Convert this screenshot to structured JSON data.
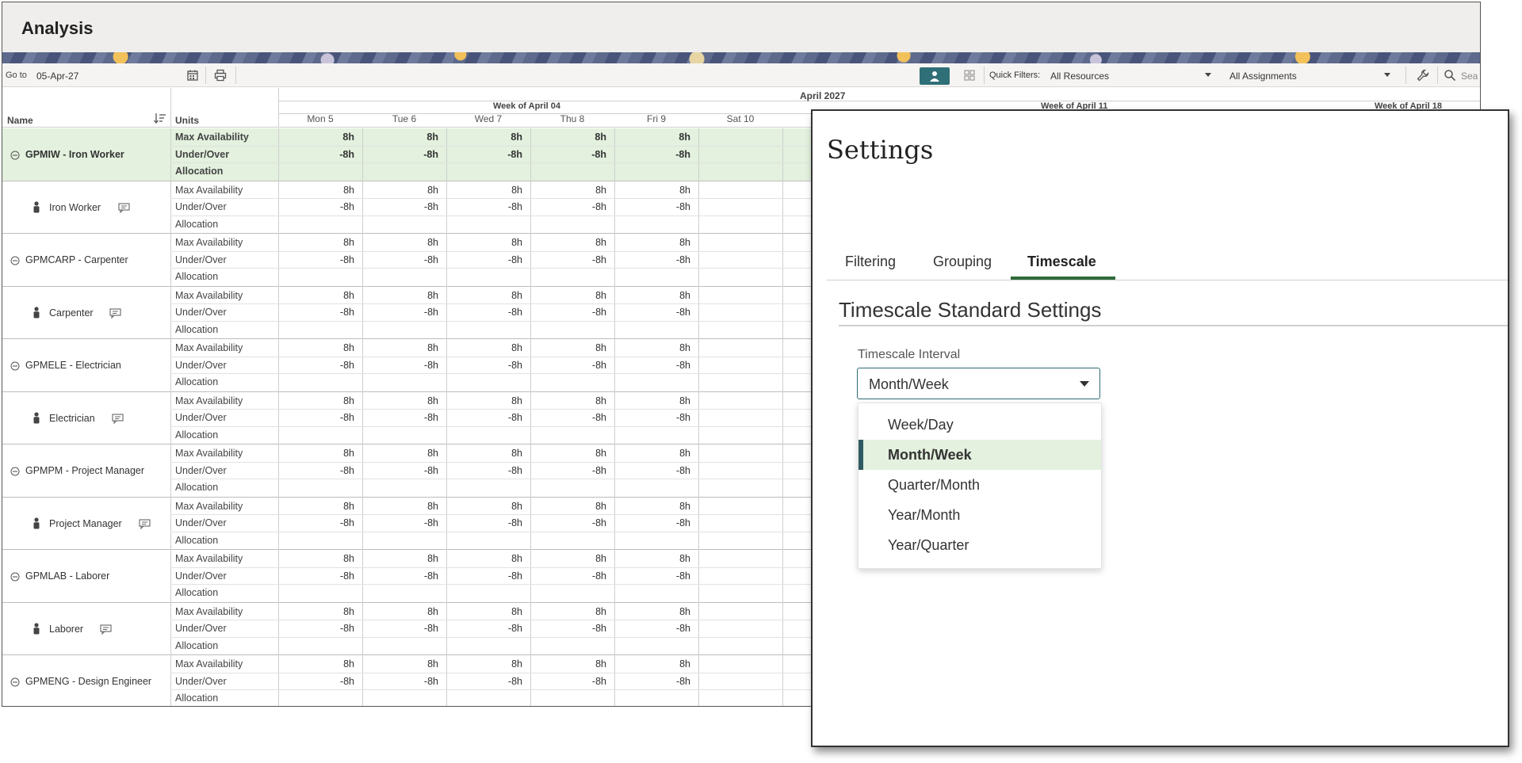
{
  "app": {
    "title": "Analysis"
  },
  "toolbar": {
    "goto_label": "Go to",
    "goto_value": "05-Apr-27",
    "quick_filters_label": "Quick Filters:",
    "resource_filter": "All Resources",
    "assignment_filter": "All Assignments",
    "search_placeholder": "Sea"
  },
  "grid": {
    "headers": {
      "name": "Name",
      "units": "Units"
    },
    "month": "April 2027",
    "weeks": [
      "Week of April 04",
      "Week of April 11",
      "Week of April 18"
    ],
    "days": [
      "Mon 5",
      "Tue 6",
      "Wed 7",
      "Thu 8",
      "Fri 9",
      "Sat 10"
    ],
    "unit_labels": [
      "Max Availability",
      "Under/Over",
      "Allocation"
    ],
    "rows": [
      {
        "name": "GPMIW - Iron Worker",
        "type": "group",
        "max": "8h",
        "under": "-8h"
      },
      {
        "name": "Iron Worker",
        "type": "resource",
        "max": "8h",
        "under": "-8h"
      },
      {
        "name": "GPMCARP - Carpenter",
        "type": "group",
        "max": "8h",
        "under": "-8h"
      },
      {
        "name": "Carpenter",
        "type": "resource",
        "max": "8h",
        "under": "-8h"
      },
      {
        "name": "GPMELE - Electrician",
        "type": "group",
        "max": "8h",
        "under": "-8h"
      },
      {
        "name": "Electrician",
        "type": "resource",
        "max": "8h",
        "under": "-8h"
      },
      {
        "name": "GPMPM - Project Manager",
        "type": "group",
        "max": "8h",
        "under": "-8h"
      },
      {
        "name": "Project Manager",
        "type": "resource",
        "max": "8h",
        "under": "-8h"
      },
      {
        "name": "GPMLAB - Laborer",
        "type": "group",
        "max": "8h",
        "under": "-8h"
      },
      {
        "name": "Laborer",
        "type": "resource",
        "max": "8h",
        "under": "-8h"
      },
      {
        "name": "GPMENG - Design Engineer",
        "type": "group",
        "max": "8h",
        "under": "-8h"
      }
    ]
  },
  "settings": {
    "title": "Settings",
    "tabs": [
      "Filtering",
      "Grouping",
      "Timescale"
    ],
    "active_tab": "Timescale",
    "section_title": "Timescale Standard Settings",
    "interval_label": "Timescale Interval",
    "interval_value": "Month/Week",
    "options": [
      "Week/Day",
      "Month/Week",
      "Quarter/Month",
      "Year/Month",
      "Year/Quarter"
    ],
    "selected_option": "Month/Week"
  },
  "colors": {
    "highlight": "#e3f1de",
    "accent": "#2f6b3c",
    "toggle_active": "#2f6f77"
  }
}
